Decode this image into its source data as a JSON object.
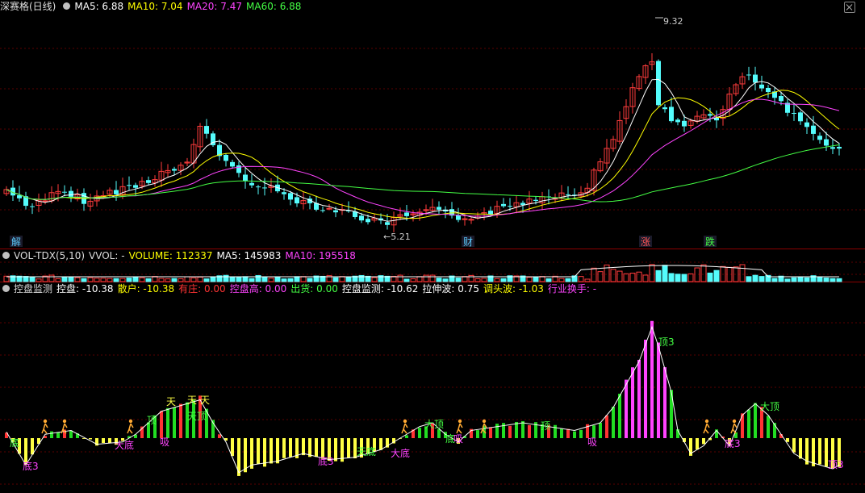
{
  "header": {
    "title": "深赛格(日线)",
    "ma": [
      {
        "label": "MA5: 6.88",
        "color": "#ffffff"
      },
      {
        "label": "MA10: 7.04",
        "color": "#ffff00"
      },
      {
        "label": "MA20: 7.47",
        "color": "#ff44ff"
      },
      {
        "label": "MA60: 6.88",
        "color": "#44ff44"
      }
    ]
  },
  "price_annotations": {
    "high": "9.32",
    "low": "5.21",
    "markers": [
      "解",
      "财",
      "涨",
      "跌"
    ]
  },
  "volume_header": {
    "title": "VOL-TDX(5,10)",
    "items": [
      {
        "label": "VVOL: -",
        "color": "#dddddd"
      },
      {
        "label": "VOLUME: 112337",
        "color": "#ffff00"
      },
      {
        "label": "MA5: 145983",
        "color": "#ffffff"
      },
      {
        "label": "MA10: 195518",
        "color": "#ff44ff"
      }
    ]
  },
  "indicator_header": {
    "title": "控盘监测",
    "items": [
      {
        "label": "控盘: -10.38",
        "color": "#ffffff"
      },
      {
        "label": "散户: -10.38",
        "color": "#ffff00"
      },
      {
        "label": "有庄: 0.00",
        "color": "#ff3333"
      },
      {
        "label": "控盘高: 0.00",
        "color": "#ff44ff"
      },
      {
        "label": "出货: 0.00",
        "color": "#44ff44"
      },
      {
        "label": "控盘监测: -10.62",
        "color": "#ffffff"
      },
      {
        "label": "拉伸波: 0.75",
        "color": "#ffffff"
      },
      {
        "label": "调头波: -1.03",
        "color": "#ffff00"
      },
      {
        "label": "行业换手: -",
        "color": "#ff44ff"
      }
    ]
  },
  "indicator_labels": [
    "底3",
    "底",
    "大底",
    "吸",
    "顶",
    "天",
    "天顶",
    "天",
    "底3",
    "天底",
    "大底",
    "吸",
    "顶",
    "大顶",
    "底",
    "顶3",
    "吸",
    "底3",
    "大顶",
    "顶3",
    "天"
  ],
  "colors": {
    "up": "#ff3c3c",
    "down": "#54fcfc",
    "ma5": "#ffffff",
    "ma10": "#ffff00",
    "ma20": "#ff44ff",
    "ma60": "#44ff44"
  }
}
